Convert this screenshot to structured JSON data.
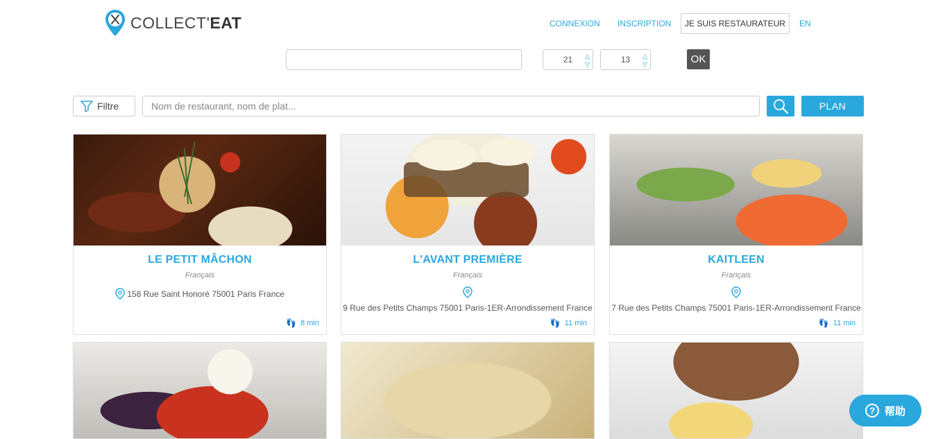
{
  "header": {
    "logo_light": "COLLECT'",
    "logo_bold": "EAT",
    "nav": {
      "login": "CONNEXION",
      "signup": "INSCRIPTION",
      "restaurateur": "JE SUIS RESTAURATEUR",
      "lang": "EN"
    }
  },
  "search_row1": {
    "address_value": "",
    "hour_value": "21",
    "minute_value": "13",
    "ok_label": "OK"
  },
  "search_row2": {
    "filter_label": "Filtre",
    "search_placeholder": "Nom de restaurant, nom de plat...",
    "plan_label": "PLAN"
  },
  "restaurants": [
    {
      "name": "LE PETIT MÂCHON",
      "cuisine": "Français",
      "address": "158 Rue Saint Honoré 75001 Paris France",
      "walk": "8 min"
    },
    {
      "name": "L'AVANT PREMIÈRE",
      "cuisine": "Français",
      "address": "9 Rue des Petits Champs 75001 Paris-1ER-Arrondissement France",
      "walk": "11 min"
    },
    {
      "name": "KAITLEEN",
      "cuisine": "Français",
      "address": "7 Rue des Petits Champs 75001 Paris-1ER-Arrondissement France",
      "walk": "11 min"
    }
  ],
  "help": {
    "label": "帮助"
  },
  "colors": {
    "accent": "#2aa8dd",
    "ok_button": "#555555"
  }
}
